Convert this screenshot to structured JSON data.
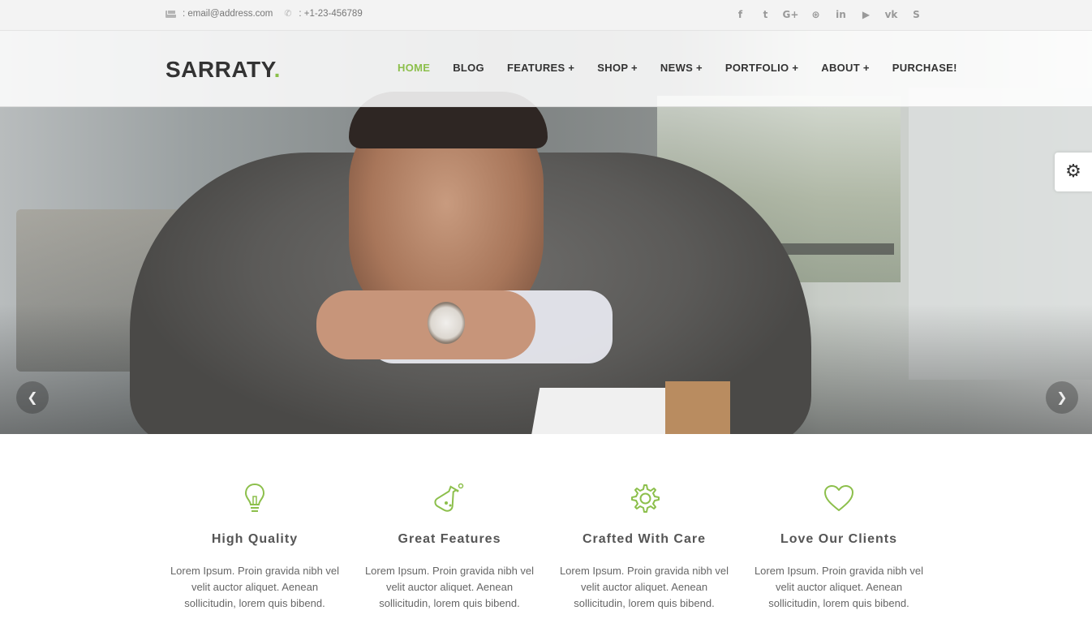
{
  "topbar": {
    "email": ": email@address.com",
    "phone": ": +1-23-456789",
    "social_icons": [
      "facebook-icon",
      "twitter-icon",
      "google-plus-icon",
      "dribbble-icon",
      "linkedin-icon",
      "youtube-icon",
      "vk-icon",
      "skype-icon"
    ],
    "social_glyphs": [
      "f",
      "t",
      "G+",
      "⊛",
      "in",
      "▶",
      "vk",
      "S"
    ]
  },
  "header": {
    "logo": "SARRATY",
    "logo_dot": ".",
    "menu": [
      {
        "label": "HOME",
        "active": true
      },
      {
        "label": "BLOG",
        "active": false
      },
      {
        "label": "FEATURES +",
        "active": false
      },
      {
        "label": "SHOP +",
        "active": false
      },
      {
        "label": "NEWS +",
        "active": false
      },
      {
        "label": "PORTFOLIO +",
        "active": false
      },
      {
        "label": "ABOUT +",
        "active": false
      },
      {
        "label": "PURCHASE!",
        "active": false
      }
    ]
  },
  "slider": {
    "prev_glyph": "❮",
    "next_glyph": "❯"
  },
  "settings": {
    "glyph": "⚙"
  },
  "features": [
    {
      "icon": "lightbulb-icon",
      "title": "High Quality",
      "text": "Lorem Ipsum. Proin gravida nibh vel velit auctor aliquet. Aenean sollicitudin, lorem quis bibend."
    },
    {
      "icon": "flask-icon",
      "title": "Great Features",
      "text": "Lorem Ipsum. Proin gravida nibh vel velit auctor aliquet. Aenean sollicitudin, lorem quis bibend."
    },
    {
      "icon": "gear-icon",
      "title": "Crafted With Care",
      "text": "Lorem Ipsum. Proin gravida nibh vel velit auctor aliquet. Aenean sollicitudin, lorem quis bibend."
    },
    {
      "icon": "heart-icon",
      "title": "Love Our Clients",
      "text": "Lorem Ipsum. Proin gravida nibh vel velit auctor aliquet. Aenean sollicitudin, lorem quis bibend."
    }
  ],
  "colors": {
    "accent": "#8cbf4b",
    "text_dark": "#333333",
    "topbar_bg": "#f3f3f3"
  }
}
